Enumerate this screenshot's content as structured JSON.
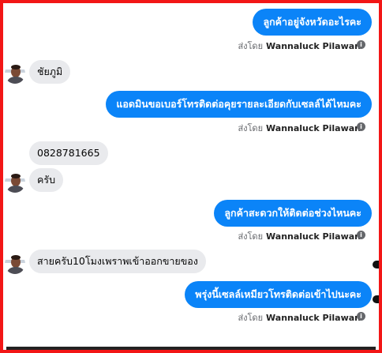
{
  "conversation": {
    "messages": [
      {
        "text": "ลูกค้าอยู่จังหวัดอะไรคะ",
        "direction": "out"
      },
      {
        "text": "ชัยภูมิ",
        "direction": "in"
      },
      {
        "text": "แอดมินขอเบอร์โทรติดต่อคุยรายละเอียดกับเซลล์ได้ไหมคะ",
        "direction": "out"
      },
      {
        "text": "0828781665",
        "direction": "in"
      },
      {
        "text": "ครับ",
        "direction": "in"
      },
      {
        "text": "ลูกค้าสะดวกให้ติดต่อช่วงไหนคะ",
        "direction": "out"
      },
      {
        "text": "สายครับ10โมงเพราพเข้าออกขายของ",
        "direction": "in"
      },
      {
        "text": "พรุ่งนี้เซลล์เหมียวโทรติดต่อเข้าไปนะคะ",
        "direction": "out"
      }
    ],
    "sent_by_label": "ส่งโดย",
    "sender_name": "Wannaluck Pilawan",
    "info_icon": "i"
  },
  "colors": {
    "outgoing_bubble": "#0b84f8",
    "incoming_bubble": "#e9eaed",
    "frame_border": "#f21616"
  },
  "icons": {
    "avatar": "avatar-icon",
    "info": "info-icon"
  }
}
